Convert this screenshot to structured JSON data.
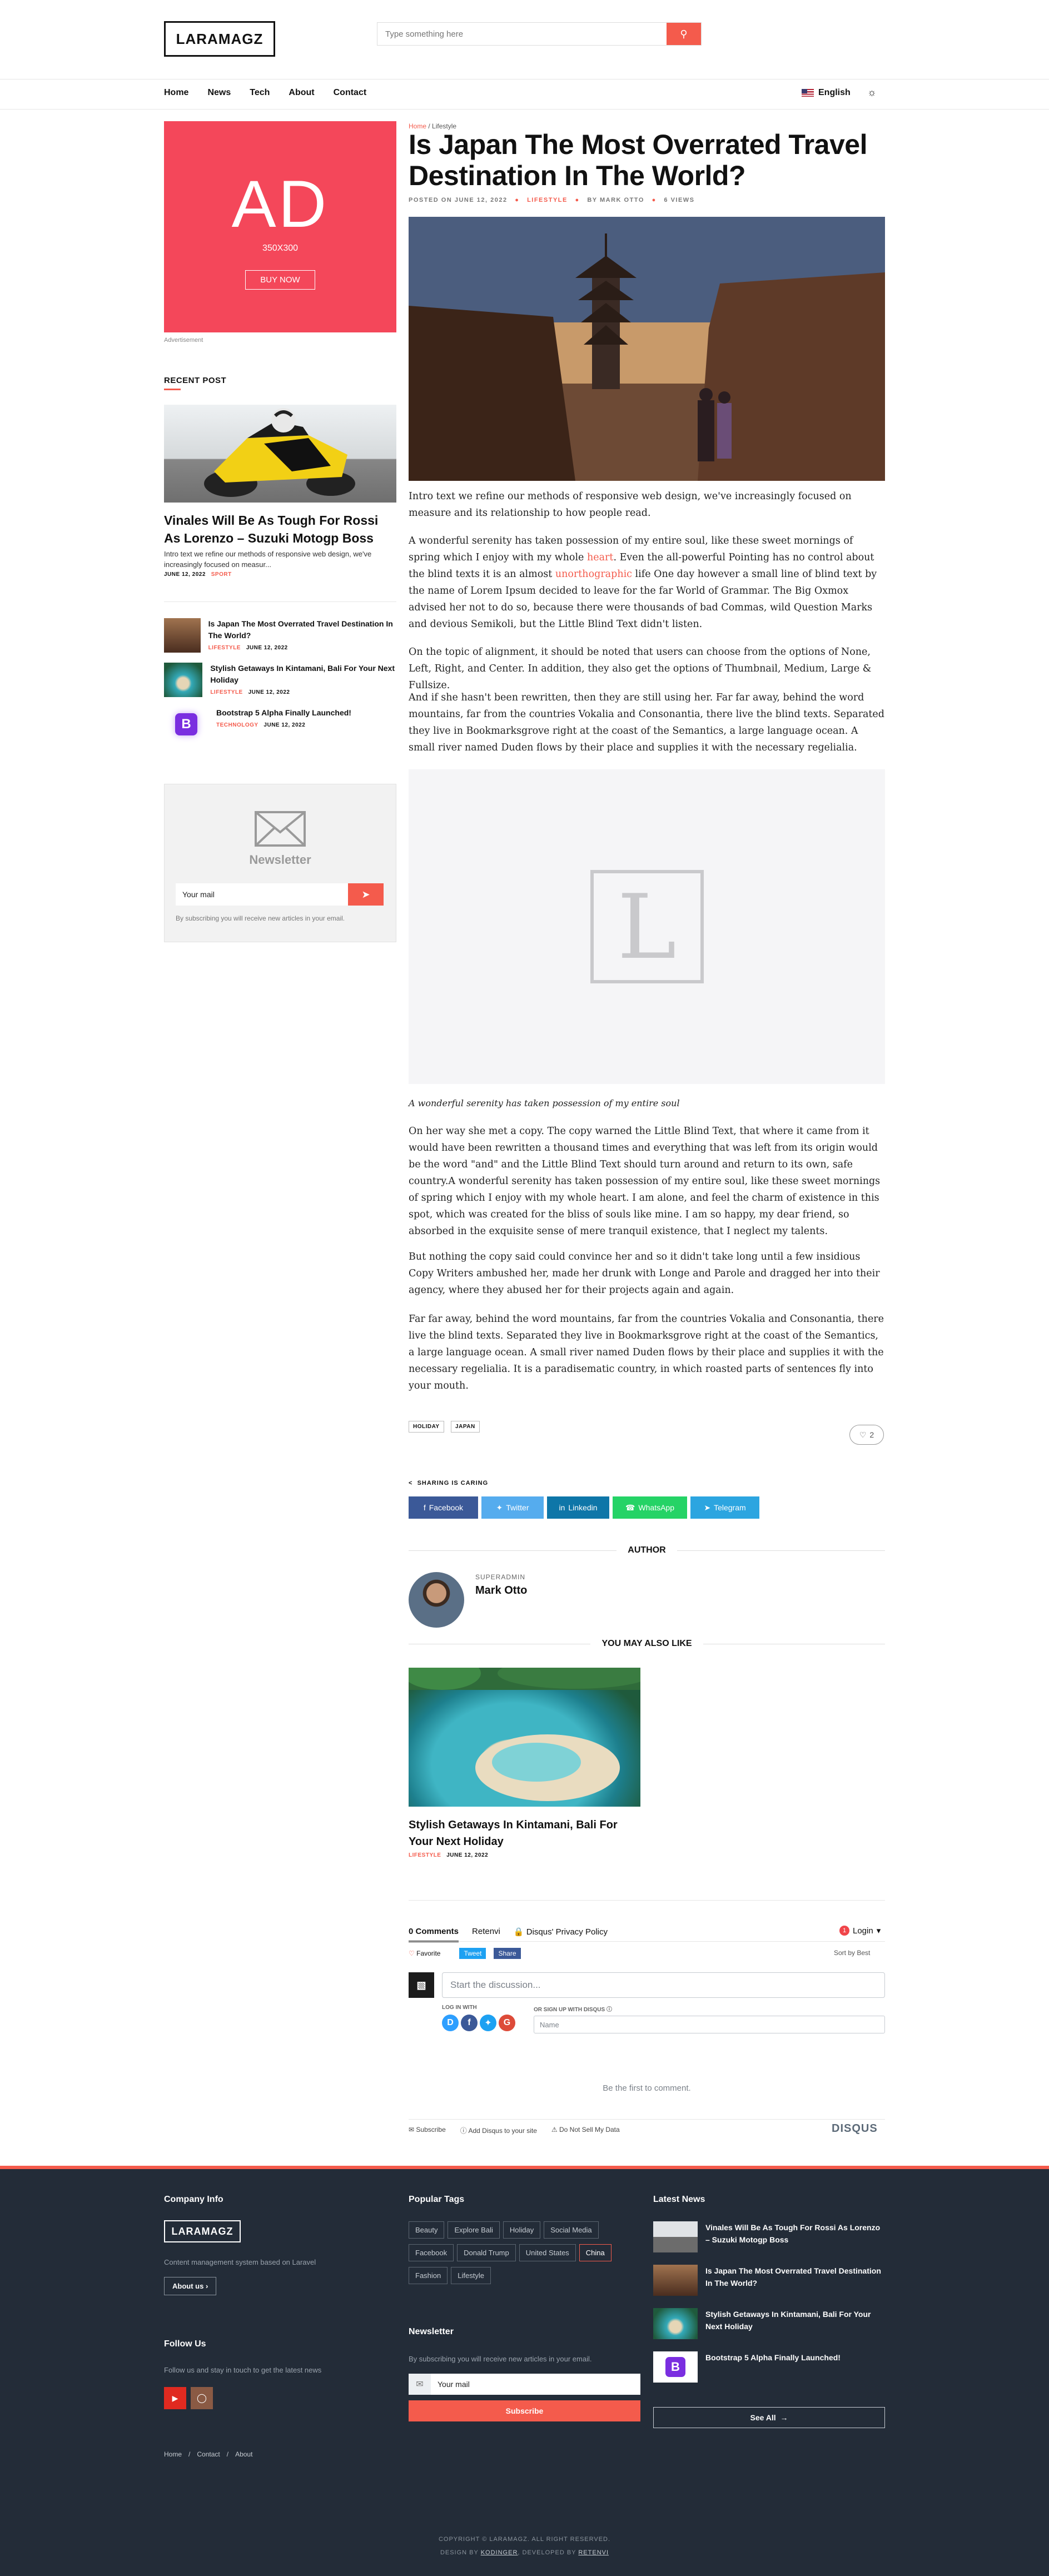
{
  "header": {
    "logo": "LARAMAGZ",
    "search_placeholder": "Type something here",
    "nav": [
      "Home",
      "News",
      "Tech",
      "About",
      "Contact"
    ],
    "language": "English"
  },
  "sidebar": {
    "ad": {
      "big": "AD",
      "size": "350X300",
      "buy": "BUY NOW",
      "caption": "Advertisement"
    },
    "recent_heading": "RECENT POST",
    "featured": {
      "title": "Vinales Will Be As Tough For Rossi As Lorenzo – Suzuki Motogp Boss",
      "excerpt": "Intro text we refine our methods of responsive web design, we've increasingly focused on measur...",
      "date": "JUNE 12, 2022",
      "category": "SPORT"
    },
    "small_posts": [
      {
        "title": "Is Japan The Most Overrated Travel Destination In The World?",
        "category": "LIFESTYLE",
        "date": "JUNE 12, 2022"
      },
      {
        "title": "Stylish Getaways In Kintamani, Bali For Your Next Holiday",
        "category": "LIFESTYLE",
        "date": "JUNE 12, 2022"
      },
      {
        "title": "Bootstrap 5 Alpha Finally Launched!",
        "category": "TECHNOLOGY",
        "date": "JUNE 12, 2022"
      }
    ],
    "newsletter": {
      "title": "Newsletter",
      "placeholder": "Your mail",
      "note": "By subscribing you will receive new articles in your email."
    }
  },
  "article": {
    "breadcrumb": {
      "home": "Home",
      "sep": "/",
      "current": "Lifestyle"
    },
    "title": "Is Japan The Most Overrated Travel Destination In The World?",
    "meta": {
      "posted": "POSTED ON JUNE 12, 2022",
      "category": "LIFESTYLE",
      "author": "BY MARK OTTO",
      "views": "6 VIEWS"
    },
    "intro": "Intro text we refine our methods of responsive web design, we've increasingly focused on measure and its relationship to how people read.",
    "p1a": "A wonderful serenity has taken possession of my entire soul, like these sweet mornings of spring which I enjoy with my whole ",
    "p1_link1": "heart",
    "p1b": ". Even the all-powerful Pointing has no control about the blind texts it is an almost ",
    "p1_link2": "unorthographic",
    "p1c": " life One day however a small line of blind text by the name of Lorem Ipsum decided to leave for the far World of Grammar. The Big Oxmox advised her not to do so, because there were thousands of bad Commas, wild Question Marks and devious Semikoli, but the Little Blind Text didn't listen.",
    "p2": "On the topic of alignment, it should be noted that users can choose from the options of None, Left, Right, and Center. In addition, they also get the options of Thumbnail, Medium, Large & Fullsize.",
    "p3": "And if she hasn't been rewritten, then they are still using her. Far far away, behind the word mountains, far from the countries Vokalia and Consonantia, there live the blind texts. Separated they live in Bookmarksgrove right at the coast of the Semantics, a large language ocean. A small river named Duden flows by their place and supplies it with the necessary regelialia.",
    "placeholder_letter": "L",
    "caption": "A wonderful serenity has taken possession of my entire soul",
    "p4": "On her way she met a copy. The copy warned the Little Blind Text, that where it came from it would have been rewritten a thousand times and everything that was left from its origin would be the word \"and\" and the Little Blind Text should turn around and return to its own, safe country.A wonderful serenity has taken possession of my entire soul, like these sweet mornings of spring which I enjoy with my whole heart. I am alone, and feel the charm of existence in this spot, which was created for the bliss of souls like mine. I am so happy, my dear friend, so absorbed in the exquisite sense of mere tranquil existence, that I neglect my talents.",
    "p5": "But nothing the copy said could convince her and so it didn't take long until a few insidious Copy Writers ambushed her, made her drunk with Longe and Parole and dragged her into their agency, where they abused her for their projects again and again.",
    "p6": "Far far away, behind the word mountains, far from the countries Vokalia and Consonantia, there live the blind texts. Separated they live in Bookmarksgrove right at the coast of the Semantics, a large language ocean. A small river named Duden flows by their place and supplies it with the necessary regelialia. It is a paradisematic country, in which roasted parts of sentences fly into your mouth.",
    "tags": [
      "HOLIDAY",
      "JAPAN"
    ],
    "likes": "2",
    "share_heading": "SHARING IS CARING",
    "share": [
      {
        "label": "Facebook",
        "color": "#3b5998"
      },
      {
        "label": "Twitter",
        "color": "#55acee"
      },
      {
        "label": "Linkedin",
        "color": "#0e76a8"
      },
      {
        "label": "WhatsApp",
        "color": "#25d366"
      },
      {
        "label": "Telegram",
        "color": "#2ca5e0"
      }
    ],
    "author_heading": "AUTHOR",
    "author_role": "SUPERADMIN",
    "author_name": "Mark Otto",
    "also_heading": "YOU MAY ALSO LIKE",
    "related": {
      "title": "Stylish Getaways In Kintamani, Bali For Your Next Holiday",
      "category": "LIFESTYLE",
      "date": "JUNE 12, 2022"
    }
  },
  "disqus": {
    "comments": "0 Comments",
    "site": "Retenvi",
    "privacy": "Disqus' Privacy Policy",
    "login": "Login",
    "favorite": "Favorite",
    "tweet": "Tweet",
    "share": "Share",
    "sort": "Sort by Best",
    "start": "Start the discussion...",
    "log_in_with": "LOG IN WITH",
    "or_sign_up": "OR SIGN UP WITH DISQUS",
    "name_placeholder": "Name",
    "first": "Be the first to comment.",
    "subscribe": "Subscribe",
    "add": "Add Disqus to your site",
    "dnsmd": "Do Not Sell My Data",
    "brand": "DISQUS"
  },
  "footer": {
    "company_heading": "Company Info",
    "logo": "LARAMAGZ",
    "company_desc": "Content management system based on Laravel",
    "about_btn": "About us",
    "follow_heading": "Follow Us",
    "follow_desc": "Follow us and stay in touch to get the latest news",
    "links": [
      "Home",
      "Contact",
      "About"
    ],
    "tags_heading": "Popular Tags",
    "tags": [
      "Beauty",
      "Explore Bali",
      "Holiday",
      "Social Media",
      "Facebook",
      "Donald Trump",
      "United States",
      "China",
      "Fashion",
      "Lifestyle"
    ],
    "newsletter_heading": "Newsletter",
    "newsletter_desc": "By subscribing you will receive new articles in your email.",
    "mail_placeholder": "Your mail",
    "subscribe_btn": "Subscribe",
    "latest_heading": "Latest News",
    "latest": [
      "Vinales Will Be As Tough For Rossi As Lorenzo – Suzuki Motogp Boss",
      "Is Japan The Most Overrated Travel Destination In The World?",
      "Stylish Getaways In Kintamani, Bali For Your Next Holiday",
      "Bootstrap 5 Alpha Finally Launched!"
    ],
    "see_all": "See All",
    "copyright": "COPYRIGHT © LARAMAGZ. ALL RIGHT RESERVED.",
    "design_prefix": "DESIGN BY",
    "designer": "KODINGER",
    "dev_prefix": ", DEVELOPED BY",
    "developer": "RETENVI"
  },
  "colors": {
    "accent": "#f45b4c",
    "ad": "#f4475a",
    "footer_bg": "#232c38"
  }
}
